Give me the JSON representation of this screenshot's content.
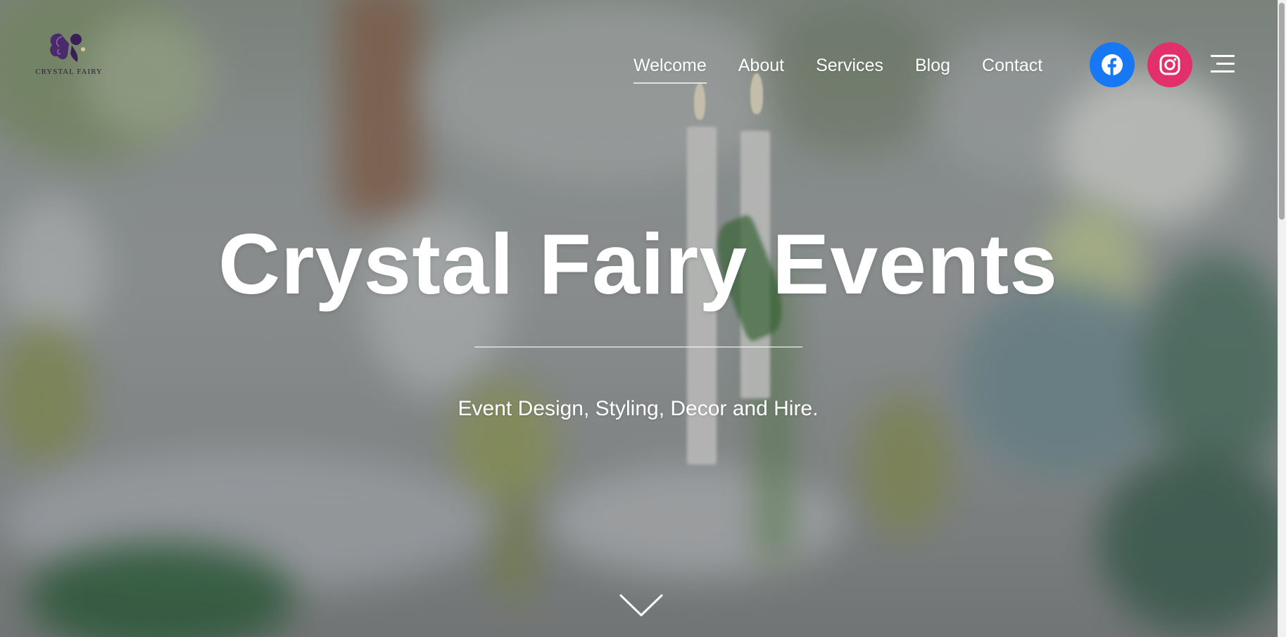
{
  "header": {
    "logo_text": "CRYSTAL FAIRY"
  },
  "nav": {
    "items": [
      {
        "label": "Welcome",
        "active": true
      },
      {
        "label": "About",
        "active": false
      },
      {
        "label": "Services",
        "active": false
      },
      {
        "label": "Blog",
        "active": false
      },
      {
        "label": "Contact",
        "active": false
      }
    ]
  },
  "social": {
    "facebook": {
      "icon": "facebook-icon",
      "color": "#1877f2"
    },
    "instagram": {
      "icon": "instagram-icon",
      "color": "#e1306c"
    }
  },
  "hero": {
    "title": "Crystal Fairy Events",
    "subtitle": "Event Design, Styling, Decor and Hire."
  },
  "icons": {
    "menu": "hamburger-menu-icon",
    "scroll": "chevron-down-icon"
  }
}
